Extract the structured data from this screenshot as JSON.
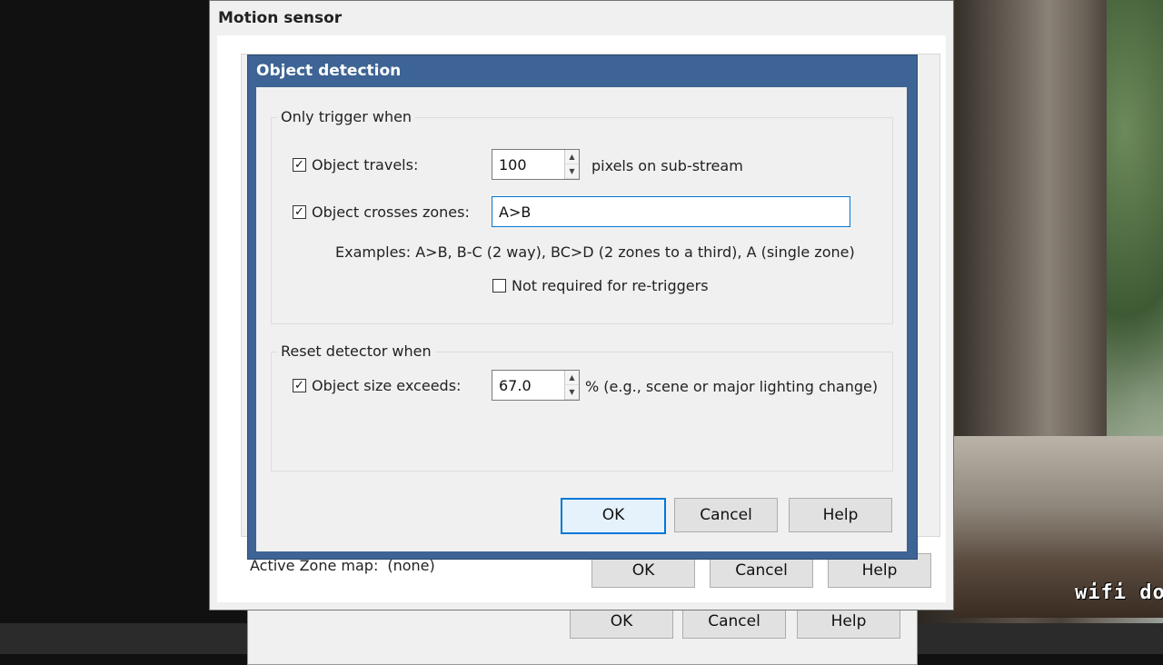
{
  "motion_window": {
    "title": "Motion sensor",
    "zone_map_label": "Active Zone map:",
    "zone_map_value": "(none)",
    "ok_label": "OK",
    "cancel_label": "Cancel",
    "help_label": "Help"
  },
  "back_window": {
    "ok_label": "OK",
    "cancel_label": "Cancel",
    "help_label": "Help"
  },
  "dialog": {
    "title": "Object detection",
    "trigger_group": {
      "title": "Only trigger when",
      "object_travels": {
        "checked": true,
        "label": "Object travels:",
        "value": "100",
        "unit": "pixels on sub-stream"
      },
      "object_crosses": {
        "checked": true,
        "label": "Object crosses zones:",
        "value": "A>B"
      },
      "examples": "Examples:  A>B, B-C (2 way), BC>D (2 zones to a third), A (single zone)",
      "not_required": {
        "checked": false,
        "label": "Not required for re-triggers"
      }
    },
    "reset_group": {
      "title": "Reset detector when",
      "object_size": {
        "checked": true,
        "label": "Object size exceeds:",
        "value": "67.0",
        "unit": "% (e.g., scene or major lighting change)"
      }
    },
    "ok_label": "OK",
    "cancel_label": "Cancel",
    "help_label": "Help"
  },
  "camera": {
    "overlay_text": "wifi do"
  }
}
